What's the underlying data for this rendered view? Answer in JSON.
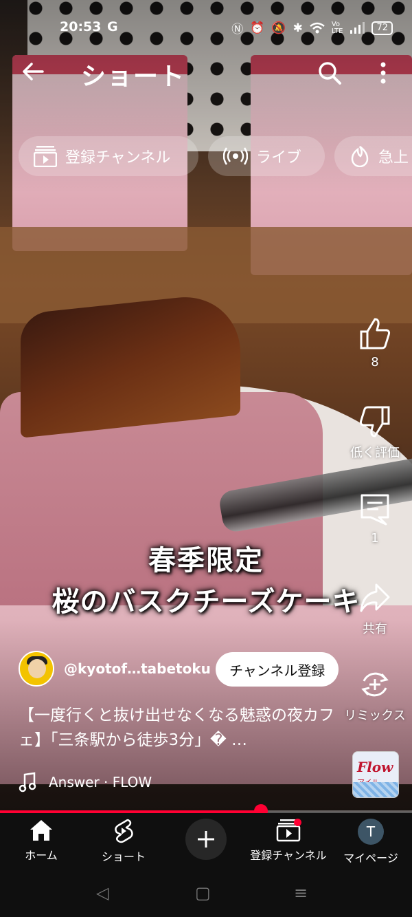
{
  "status_bar": {
    "time": "20:53",
    "g_label": "G",
    "battery": "72",
    "icons": [
      "nfc-icon",
      "alarm-icon",
      "mute-icon",
      "bluetooth-icon",
      "wifi-icon",
      "volte-icon",
      "signal-icon"
    ]
  },
  "header": {
    "title": "ショート",
    "back_icon": "back-arrow-icon",
    "search_icon": "search-icon",
    "more_icon": "more-vert-icon"
  },
  "chips": [
    {
      "label": "登録チャンネル",
      "icon": "subscriptions-icon"
    },
    {
      "label": "ライブ",
      "icon": "live-icon"
    },
    {
      "label": "急上",
      "icon": "trending-icon"
    }
  ],
  "actions": {
    "like_count": "8",
    "dislike_label": "低く評価",
    "comment_count": "1",
    "share_label": "共有",
    "remix_label": "リミックス"
  },
  "caption": {
    "line1": "春季限定",
    "line2": "桜のバスクチーズケーキ"
  },
  "channel": {
    "handle": "@kyotof…tabetoku",
    "subscribe_label": "チャンネル登録"
  },
  "description": "【一度行くと抜け出せなくなる魅惑の夜カフェ】「三条駅から徒歩3分」� …",
  "music": {
    "track": "Answer · FLOW"
  },
  "thumbnail": {
    "title": "Flow",
    "subtitle": "アイル"
  },
  "progress": {
    "fraction": 0.633
  },
  "nav": {
    "home": "ホーム",
    "shorts": "ショート",
    "subscriptions": "登録チャンネル",
    "mypage": "マイページ",
    "avatar_letter": "T"
  },
  "colors": {
    "accent": "#ff0033",
    "nav_bg": "#0f0f0f"
  }
}
